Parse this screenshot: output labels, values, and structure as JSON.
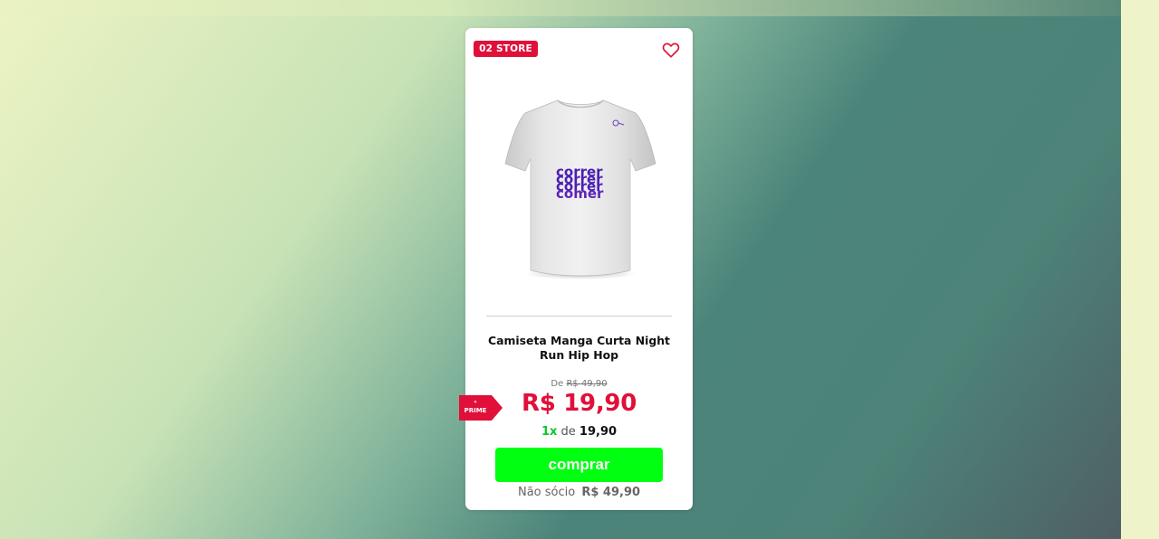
{
  "card": {
    "store_badge": "02 STORE",
    "title": "Camiseta Manga Curta Night Run Hip Hop",
    "old_price_prefix": "De",
    "old_price": "R$ 49,90",
    "price": "R$ 19,90",
    "prime_label": "PRIME",
    "installments": {
      "count": "1x",
      "connector": "de",
      "amount": "19,90"
    },
    "buy_label": "comprar",
    "nonmember_label": "Não sócio",
    "nonmember_price": "R$ 49,90",
    "shirt_print": [
      "correr",
      "correr",
      "correr",
      "comer"
    ]
  },
  "colors": {
    "brand_red": "#e0103a",
    "buy_green": "#00ff10",
    "installment_green": "#10c62a",
    "print_purple": "#4b1fb3"
  },
  "icons": {
    "favorite": "heart-outline-icon",
    "prime": "prime-tag-icon"
  }
}
